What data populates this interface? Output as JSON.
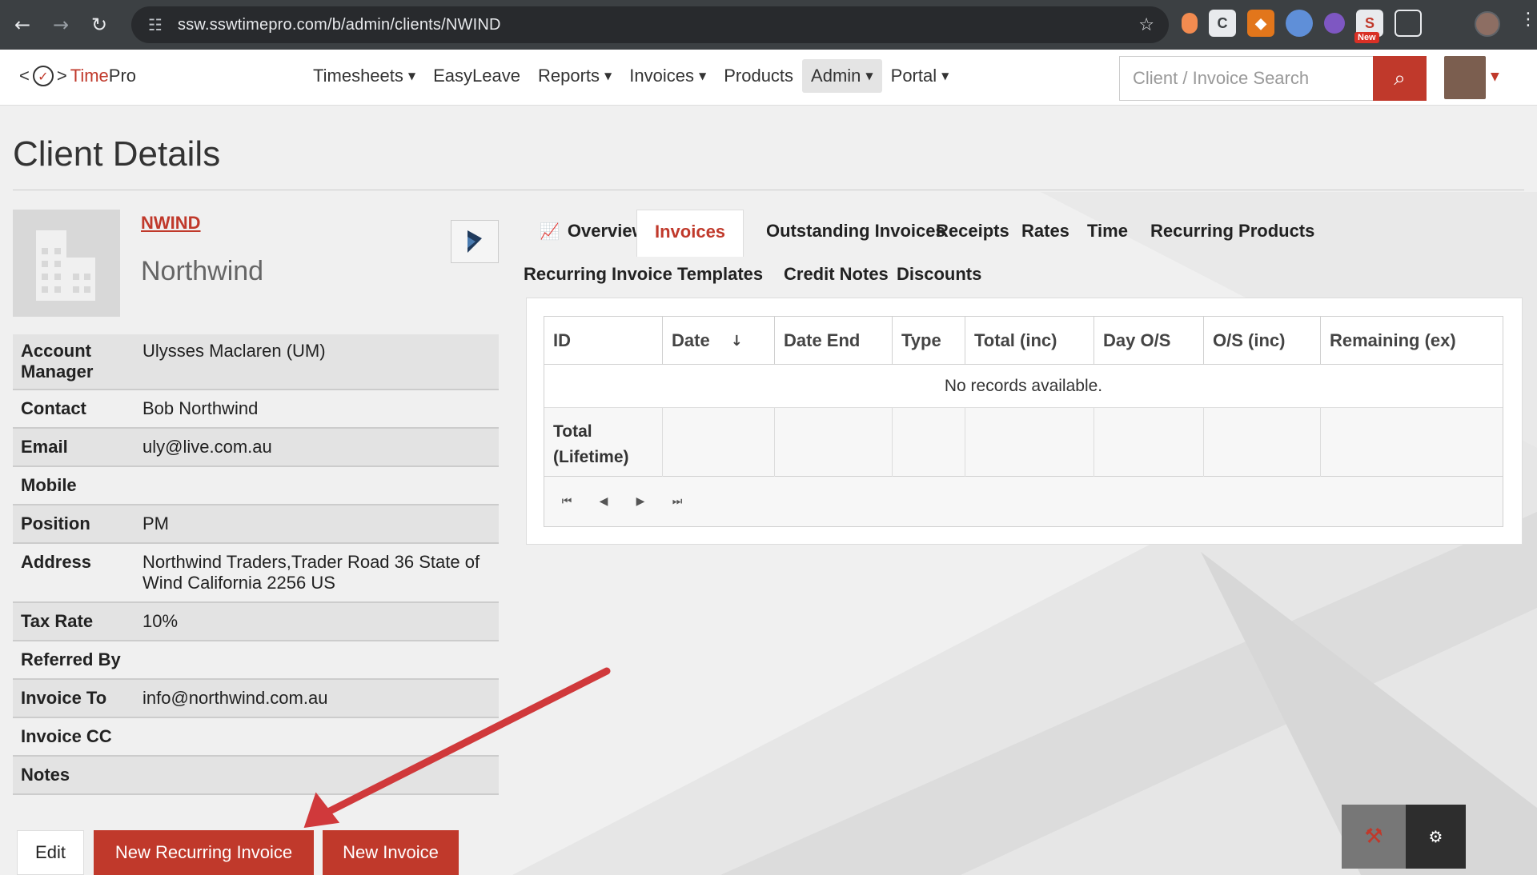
{
  "browser": {
    "url": "ssw.sswtimepro.com/b/admin/clients/NWIND",
    "extension_badge": "New"
  },
  "header": {
    "logo_left": "<",
    "logo_right": ">",
    "logo_time": "Time",
    "logo_pro": "Pro",
    "nav": [
      {
        "label": "Timesheets",
        "dropdown": true
      },
      {
        "label": "EasyLeave",
        "dropdown": false
      },
      {
        "label": "Reports",
        "dropdown": true
      },
      {
        "label": "Invoices",
        "dropdown": true
      },
      {
        "label": "Products",
        "dropdown": false
      },
      {
        "label": "Admin",
        "dropdown": true,
        "active": true
      },
      {
        "label": "Portal",
        "dropdown": true
      }
    ],
    "search_placeholder": "Client / Invoice Search"
  },
  "page": {
    "title": "Client Details"
  },
  "client": {
    "code": "NWIND",
    "name": "Northwind",
    "details": [
      {
        "label": "Account Manager",
        "value": "Ulysses Maclaren (UM)"
      },
      {
        "label": "Contact",
        "value": "Bob Northwind"
      },
      {
        "label": "Email",
        "value": "uly@live.com.au"
      },
      {
        "label": "Mobile",
        "value": ""
      },
      {
        "label": "Position",
        "value": "PM"
      },
      {
        "label": "Address",
        "value": "Northwind Traders,Trader Road 36 State of Wind California 2256 US"
      },
      {
        "label": "Tax Rate",
        "value": "10%"
      },
      {
        "label": "Referred By",
        "value": ""
      },
      {
        "label": "Invoice To",
        "value": "info@northwind.com.au"
      },
      {
        "label": "Invoice CC",
        "value": ""
      },
      {
        "label": "Notes",
        "value": ""
      }
    ]
  },
  "actions": {
    "edit": "Edit",
    "new_recurring_invoice": "New Recurring Invoice",
    "new_invoice": "New Invoice"
  },
  "tabs": [
    {
      "label": "Overview",
      "icon": "chart-icon"
    },
    {
      "label": "Invoices",
      "active": true
    },
    {
      "label": "Outstanding Invoices"
    },
    {
      "label": "Receipts"
    },
    {
      "label": "Rates"
    },
    {
      "label": "Time"
    },
    {
      "label": "Recurring Products"
    },
    {
      "label": "Recurring Invoice Templates"
    },
    {
      "label": "Credit Notes"
    },
    {
      "label": "Discounts"
    }
  ],
  "grid": {
    "columns": [
      "ID",
      "Date",
      "Date End",
      "Type",
      "Total (inc)",
      "Day O/S",
      "O/S (inc)",
      "Remaining (ex)"
    ],
    "sort_column": "Date",
    "sort_direction": "descending",
    "sort_indicator": "↓",
    "empty_message": "No records available.",
    "total_label_line1": "Total",
    "total_label_line2": "(Lifetime)"
  },
  "colors": {
    "brand_red": "#c0392b",
    "chrome_dark": "#3c4043"
  }
}
